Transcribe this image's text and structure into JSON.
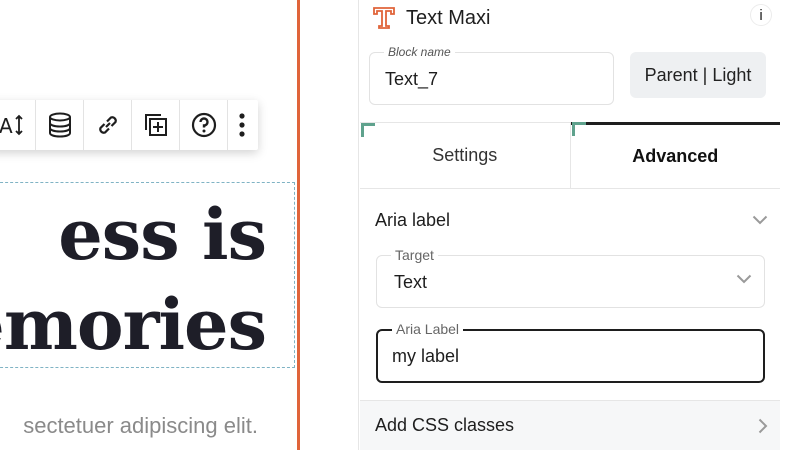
{
  "canvas": {
    "heading_line1": "ess is",
    "heading_line2": "emories",
    "body_text": "sectetuer adipiscing elit."
  },
  "toolbar": {
    "buttons": [
      {
        "icon": "text-size-icon"
      },
      {
        "icon": "database-icon"
      },
      {
        "icon": "link-icon"
      },
      {
        "icon": "duplicate-icon"
      },
      {
        "icon": "help-icon"
      },
      {
        "icon": "more-vertical-icon"
      }
    ]
  },
  "inspector": {
    "block_type_title": "Text Maxi",
    "block_icon": "text-maxi-icon",
    "info_label": "i",
    "block_name": {
      "label": "Block name",
      "value": "Text_7"
    },
    "parent_light_button": "Parent | Light",
    "tabs": [
      {
        "label": "Settings",
        "active": false
      },
      {
        "label": "Advanced",
        "active": true
      }
    ],
    "aria_section": {
      "title": "Aria label",
      "expanded": true,
      "target": {
        "label": "Target",
        "value": "Text"
      },
      "aria_label_field": {
        "label": "Aria Label",
        "value": "my label"
      }
    },
    "css_section": {
      "title": "Add CSS classes",
      "expanded": false
    }
  },
  "colors": {
    "accent_orange": "#e0643a",
    "accent_green": "#5fa28d",
    "dashed_outline": "#7fb3c4",
    "active_tab": "#1e1e1e"
  }
}
